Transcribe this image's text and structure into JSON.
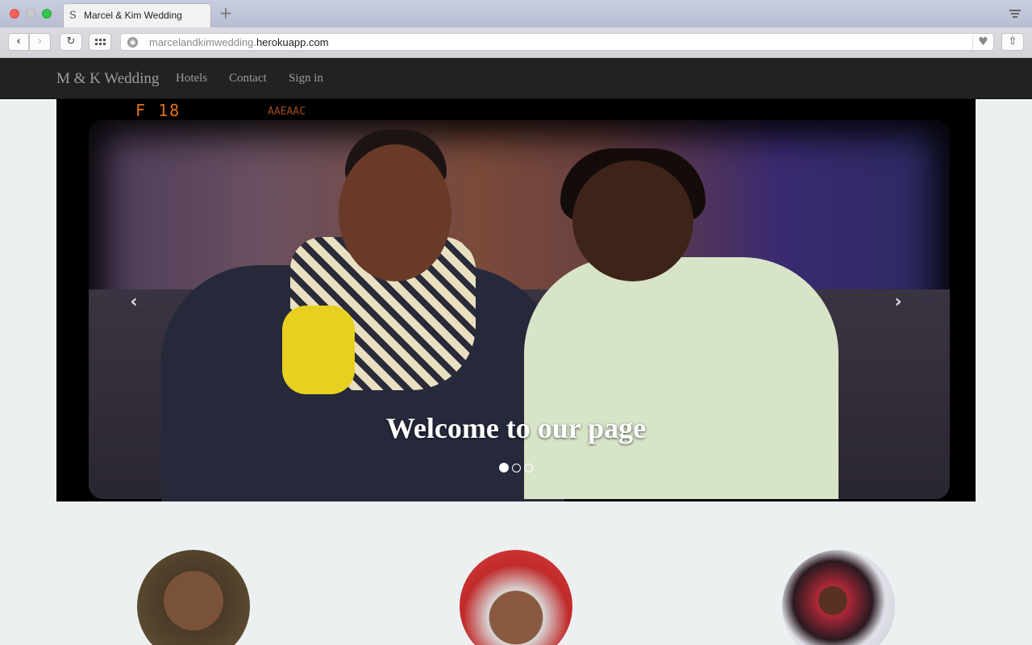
{
  "browser": {
    "tab_title": "Marcel & Kim Wedding",
    "tab_favicon": "S",
    "new_tab_label": "+",
    "url_prefix": "marcelandkimwedding.",
    "url_domain": "herokuapp.com",
    "back_glyph": "‹",
    "forward_glyph": "›",
    "reload_glyph": "↻",
    "heart_glyph": "♥",
    "share_glyph": "⇧"
  },
  "navbar": {
    "brand": "M & K Wedding",
    "links": [
      "Hotels",
      "Contact",
      "Sign in"
    ]
  },
  "carousel": {
    "caption": "Welcome to our page",
    "prev_glyph": "‹",
    "next_glyph": "›",
    "film_code": "F 18",
    "film_small": "AAEAAC",
    "active_slide": 1,
    "slide_count": 3
  },
  "avatars": [
    {
      "name": "groom-photo"
    },
    {
      "name": "ring-photo"
    },
    {
      "name": "bride-photo"
    }
  ]
}
